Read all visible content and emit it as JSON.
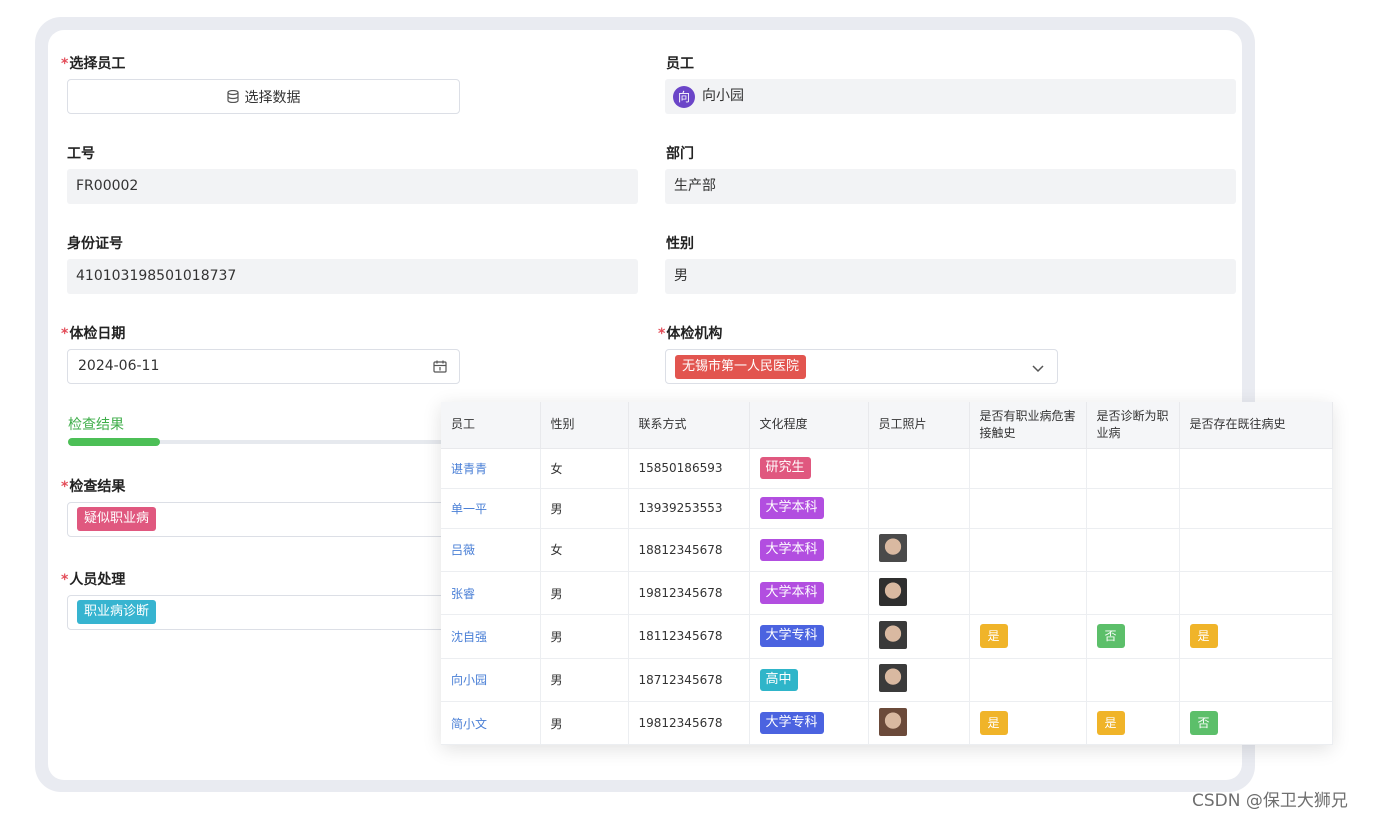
{
  "form": {
    "select_employee": {
      "label": "选择员工",
      "button_label": "选择数据"
    },
    "employee": {
      "label": "员工",
      "avatar_char": "向",
      "value": "向小园"
    },
    "job_no": {
      "label": "工号",
      "value": "FR00002"
    },
    "department": {
      "label": "部门",
      "value": "生产部"
    },
    "id_card": {
      "label": "身份证号",
      "value": "410103198501018737"
    },
    "gender": {
      "label": "性别",
      "value": "男"
    },
    "exam_date": {
      "label": "体检日期",
      "value": "2024-06-11"
    },
    "exam_org": {
      "label": "体检机构",
      "value": "无锡市第一人民医院",
      "color": "#e2554f"
    },
    "section_tab": "检查结果",
    "result": {
      "label": "检查结果",
      "value": "疑似职业病",
      "color": "#e0587f"
    },
    "handling": {
      "label": "人员处理",
      "value": "职业病诊断",
      "color": "#37b4d0"
    }
  },
  "grid": {
    "columns": [
      "员工",
      "性别",
      "联系方式",
      "文化程度",
      "员工照片",
      "是否有职业病危害接触史",
      "是否诊断为职业病",
      "是否存在既往病史"
    ],
    "rows": [
      {
        "name": "谌青青",
        "gender": "女",
        "phone": "15850186593",
        "edu": "研究生",
        "edu_color": "#e0587f",
        "photo": false,
        "c1": "",
        "c2": "",
        "c3": ""
      },
      {
        "name": "单一平",
        "gender": "男",
        "phone": "13939253553",
        "edu": "大学本科",
        "edu_color": "#b24ee0",
        "photo": false,
        "c1": "",
        "c2": "",
        "c3": ""
      },
      {
        "name": "吕薇",
        "gender": "女",
        "phone": "18812345678",
        "edu": "大学本科",
        "edu_color": "#b24ee0",
        "photo": true,
        "c1": "",
        "c2": "",
        "c3": ""
      },
      {
        "name": "张睿",
        "gender": "男",
        "phone": "19812345678",
        "edu": "大学本科",
        "edu_color": "#b24ee0",
        "photo": true,
        "c1": "",
        "c2": "",
        "c3": ""
      },
      {
        "name": "沈自强",
        "gender": "男",
        "phone": "18112345678",
        "edu": "大学专科",
        "edu_color": "#4b63e0",
        "photo": true,
        "c1": "是",
        "c2": "否",
        "c3": "是"
      },
      {
        "name": "向小园",
        "gender": "男",
        "phone": "18712345678",
        "edu": "高中",
        "edu_color": "#2fb5c9",
        "photo": true,
        "c1": "",
        "c2": "",
        "c3": ""
      },
      {
        "name": "简小文",
        "gender": "男",
        "phone": "19812345678",
        "edu": "大学专科",
        "edu_color": "#4b63e0",
        "photo": true,
        "c1": "是",
        "c2": "是",
        "c3": "否"
      }
    ],
    "yes_color": "#f0b429",
    "no_color": "#5cbf6a"
  },
  "watermark": "CSDN @保卫大狮兄"
}
